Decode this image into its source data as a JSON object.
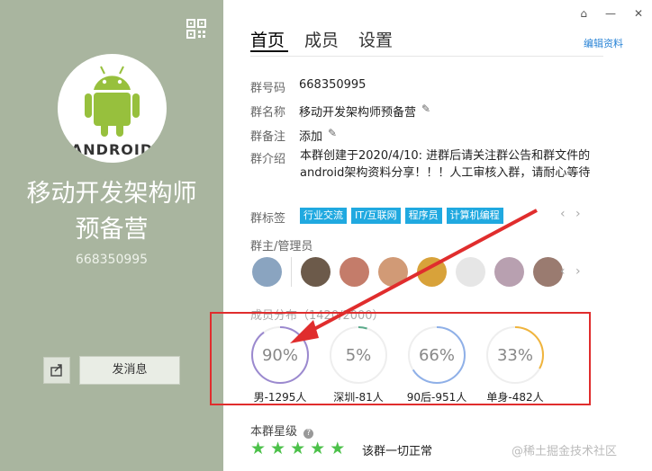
{
  "profile": {
    "group_name_line1": "移动开发架构师",
    "group_name_line2": "预备营",
    "group_number": "668350995",
    "avatar_text": "ANDROID",
    "share_icon": "share-icon",
    "send_message_label": "发消息"
  },
  "window": {
    "icons": [
      "skin-icon",
      "minimize-icon",
      "close-icon"
    ],
    "minimize_glyph": "—",
    "close_glyph": "✕"
  },
  "tabs": [
    "首页",
    "成员",
    "设置"
  ],
  "edit_profile_label": "编辑资料",
  "info": {
    "number_label": "群号码",
    "number_value": "668350995",
    "name_label": "群名称",
    "name_value": "移动开发架构师预备营",
    "remark_label": "群备注",
    "remark_value": "添加",
    "intro_label": "群介绍",
    "intro_value": "本群创建于2020/4/10: 进群后请关注群公告和群文件的android架构资料分享！！！人工审核入群，请耐心等待"
  },
  "tags": {
    "label": "群标签",
    "items": [
      "行业交流",
      "IT/互联网",
      "程序员",
      "计算机编程"
    ],
    "prev": "‹",
    "next": "›"
  },
  "admins": {
    "label": "群主/管理员",
    "count": 8,
    "prev": "‹",
    "next": "›"
  },
  "distribution": {
    "label": "成员分布（1420/2000）",
    "stats": [
      {
        "percent": "90%",
        "fraction": 0.9,
        "caption": "男-1295人",
        "color": "#9b89cf"
      },
      {
        "percent": "5%",
        "fraction": 0.05,
        "caption": "深圳-81人",
        "color": "#5aaa8a"
      },
      {
        "percent": "66%",
        "fraction": 0.66,
        "caption": "90后-951人",
        "color": "#8fb0e8"
      },
      {
        "percent": "33%",
        "fraction": 0.33,
        "caption": "单身-482人",
        "color": "#f0b43c"
      }
    ]
  },
  "rating": {
    "label": "本群星级",
    "stars": 5,
    "help_icon": "help-icon",
    "status": "该群一切正常"
  },
  "watermark": "@稀土掘金技术社区",
  "colors": {
    "left_panel": "#a9b59f",
    "tag_blue": "#20a9e0",
    "star_green": "#4cc14a",
    "highlight_red": "#e02d2d",
    "link_blue": "#2a84d6"
  }
}
